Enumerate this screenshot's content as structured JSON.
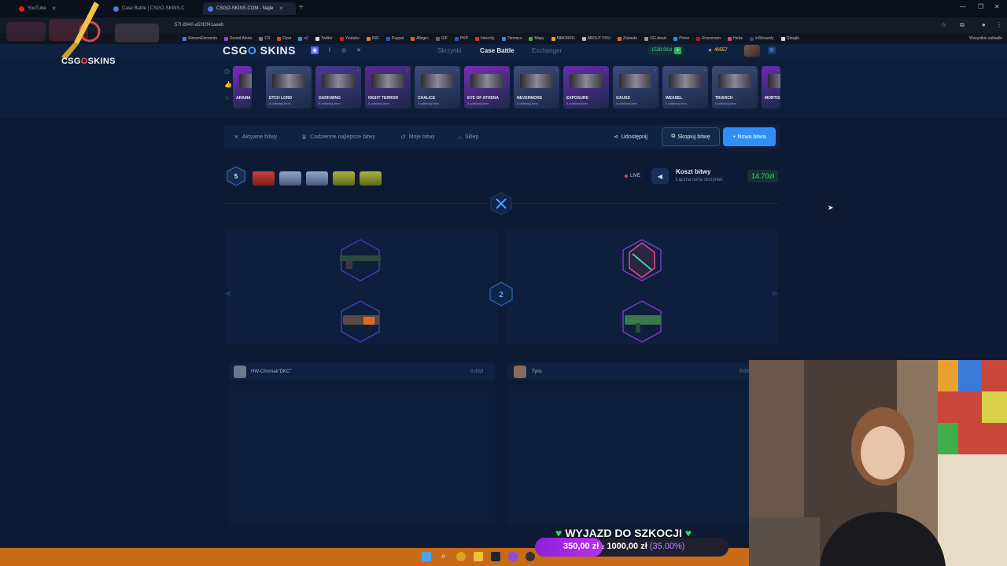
{
  "browser": {
    "tabs": [
      {
        "title": "YouTube",
        "active": false
      },
      {
        "title": "Case Battle | CSGO-SKINS.C",
        "active": false
      },
      {
        "title": "CSGO-SKINS.COM - Najle",
        "active": true
      }
    ],
    "url": "57f-8940-a50f2f41aaeb",
    "bookmarks": [
      {
        "label": "StreamElements",
        "color": "#3e7bf2"
      },
      {
        "label": "Sound Alerts",
        "color": "#8a4be0"
      },
      {
        "label": "CS",
        "color": "#777"
      },
      {
        "label": "Flyer",
        "color": "#e0453a"
      },
      {
        "label": "o2",
        "color": "#1fa0e0"
      },
      {
        "label": "Twitter",
        "color": "#ddd"
      },
      {
        "label": "Youtube",
        "color": "#e02020"
      },
      {
        "label": "ING",
        "color": "#f07a16"
      },
      {
        "label": "Paypal",
        "color": "#2a5bd7"
      },
      {
        "label": "Allegro",
        "color": "#f25a1c"
      },
      {
        "label": "GIF",
        "color": "#666"
      },
      {
        "label": "PKP",
        "color": "#2a55c8"
      },
      {
        "label": "Intercity",
        "color": "#d33"
      },
      {
        "label": "Tłumacz",
        "color": "#3d7ef0"
      },
      {
        "label": "Mapy",
        "color": "#3fae4a"
      },
      {
        "label": "MMORPG",
        "color": "#f0a020"
      },
      {
        "label": "ABOUT YOU",
        "color": "#bbb"
      },
      {
        "label": "Zalando",
        "color": "#f06020"
      },
      {
        "label": "GG.deals",
        "color": "#999"
      },
      {
        "label": "Prime",
        "color": "#2a8ff0"
      },
      {
        "label": "Rossmann",
        "color": "#c8102e"
      },
      {
        "label": "Hebe",
        "color": "#e0457a"
      },
      {
        "label": "inStreamly",
        "color": "#2c3e8f"
      },
      {
        "label": "Google",
        "color": "#ddd"
      }
    ],
    "bookmarks_right": "Wszystkie zakładki"
  },
  "overlay_logo": {
    "text_a": "CSG",
    "text_o": "O",
    "text_b": "SKINS"
  },
  "site": {
    "logo_a": "CSG",
    "logo_o": "O",
    "logo_b": " SKINS",
    "nav": [
      {
        "label": "Skrzynki",
        "active": false
      },
      {
        "label": "Case Battle",
        "active": true
      },
      {
        "label": "Exchanger",
        "active": false
      }
    ],
    "balance": "1538.96zł",
    "coins": "49557"
  },
  "drops": [
    {
      "name": "ARAMA",
      "sub": "",
      "color": "#7d2bc0"
    },
    {
      "name": "ETCH LORD",
      "sub": "5 odblokuj item",
      "color": "#3d4c78"
    },
    {
      "name": "DARKWING",
      "sub": "5 odblokuj item",
      "color": "#4a3a8e"
    },
    {
      "name": "NIGHT TERROR",
      "sub": "5 odblokuj item",
      "color": "#5a2a8e"
    },
    {
      "name": "CHALICE",
      "sub": "5 odblokuj item",
      "color": "#3d4c78"
    },
    {
      "name": "EYE OF ATHENA",
      "sub": "5 odblokuj item",
      "color": "#7b2bb8"
    },
    {
      "name": "NEVERMORE",
      "sub": "5 odblokuj item",
      "color": "#3d4c78"
    },
    {
      "name": "EXPOSURE",
      "sub": "5 odblokuj item",
      "color": "#6a2ab0"
    },
    {
      "name": "GAUSS",
      "sub": "5 odblokuj item",
      "color": "#3d4c78"
    },
    {
      "name": "WEASEL",
      "sub": "5 odblokuj item",
      "color": "#3d4c78"
    },
    {
      "name": "TRIARCH",
      "sub": "5 odblokuj item",
      "color": "#3d4c78"
    },
    {
      "name": "MORTIS",
      "sub": "",
      "color": "#6a2ab0"
    }
  ],
  "tabs": {
    "active_battles": "Aktywne bitwy",
    "daily_best": "Codzienne najlepsze bitwy",
    "my_battles": "Moje bitwy",
    "shop": "Sklep",
    "share": "Udostępnij",
    "copy": "Skopiuj bitwę",
    "new": "+ Nowa bitwa"
  },
  "battle": {
    "rounds": "5",
    "live": "LIVE",
    "cost_label": "Koszt bitwy",
    "cost_sub": "Łączna cena skrzynek",
    "cost_value": "14.70zł",
    "current_round": "2",
    "players": [
      {
        "name": "HW-Chronak\"DKC\"",
        "value": "0.00zł"
      },
      {
        "name": "Tyris",
        "value": "0.00"
      }
    ]
  },
  "goal": {
    "title": "WYJAZD DO SZKOCJI",
    "current": "350,00 zł",
    "of": "z",
    "target": "1000,00 zł",
    "percent": "(35.00%)",
    "progress_fraction": 0.35,
    "fill_color": "#b633e8"
  },
  "colors": {
    "accent": "#2f8ff5",
    "money_green": "#3fd27a",
    "background": "#0c1b33"
  }
}
